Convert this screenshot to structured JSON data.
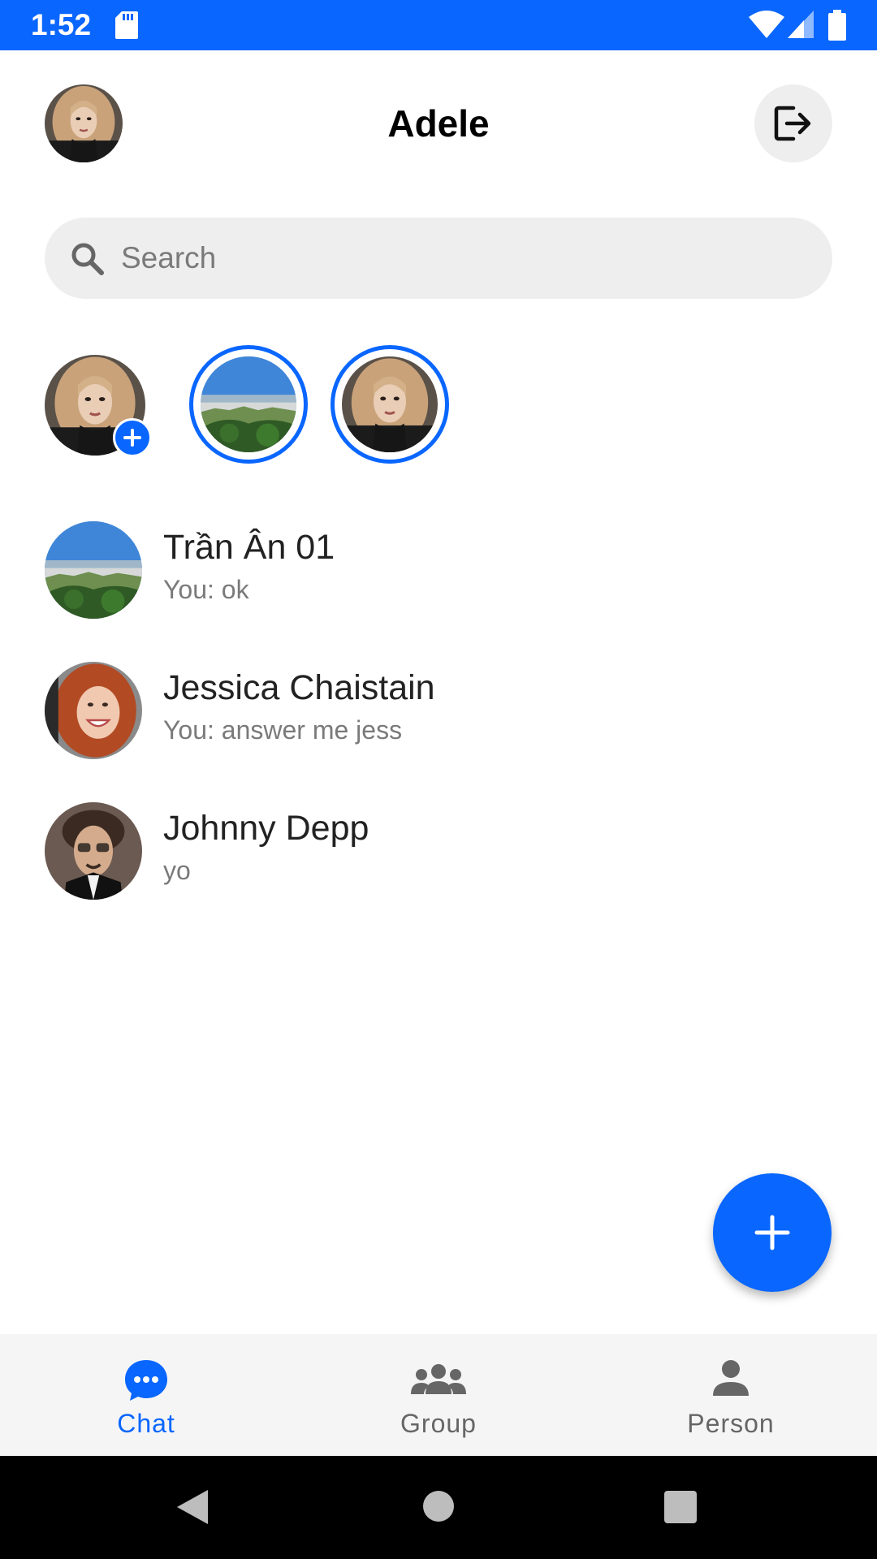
{
  "status_bar": {
    "time": "1:52"
  },
  "header": {
    "title": "Adele"
  },
  "search": {
    "placeholder": "Search"
  },
  "stories": [
    {
      "kind": "add-story"
    },
    {
      "kind": "story",
      "avatar": "landscape"
    },
    {
      "kind": "story",
      "avatar": "adele"
    }
  ],
  "chats": [
    {
      "name": "Trần Ân 01",
      "preview": "You: ok",
      "avatar": "landscape"
    },
    {
      "name": "Jessica Chaistain",
      "preview": "You: answer me jess",
      "avatar": "jessica"
    },
    {
      "name": "Johnny Depp",
      "preview": "yo",
      "avatar": "johnny"
    }
  ],
  "bottom_nav": {
    "items": [
      {
        "label": "Chat",
        "icon": "chat-bubble-icon",
        "active": true
      },
      {
        "label": "Group",
        "icon": "group-icon",
        "active": false
      },
      {
        "label": "Person",
        "icon": "person-icon",
        "active": false
      }
    ]
  },
  "colors": {
    "accent": "#0966FF",
    "nav_inactive": "#666666",
    "search_bg": "#EEEEEE"
  }
}
